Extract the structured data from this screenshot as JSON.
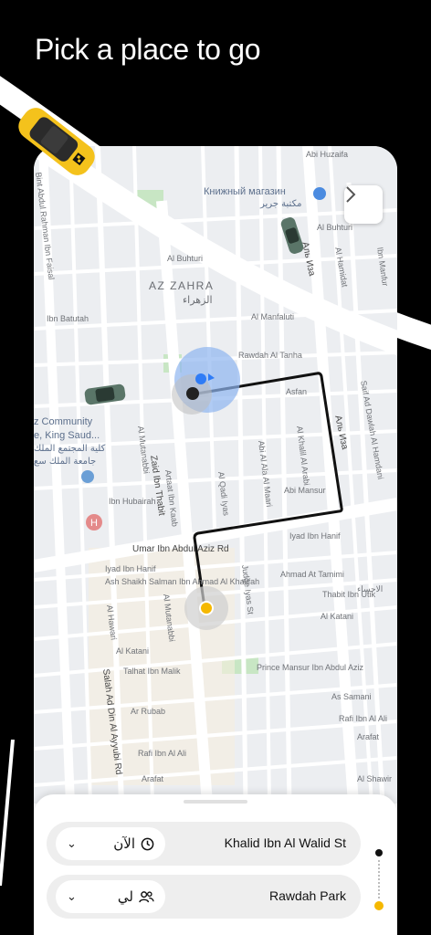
{
  "headline": "Pick a place to go",
  "map": {
    "area_title": "AZ ZAHRA",
    "area_subtitle": "الزهراء",
    "poi_bookstore": "Книжный магазин",
    "poi_bookstore_ar": "مكتبة جرير",
    "poi_community": "z Community",
    "poi_community_2": "e, King Saud...",
    "poi_community_ar": "كلية المجتمع الملك",
    "poi_community_ar2": "جامعة الملك سع",
    "streets": {
      "abi_huzaifa": "Abi Huzaifa",
      "al_buhturi_1": "Al Buhturi",
      "al_buhturi_2": "Al Buhturi",
      "ibn_batutah": "Ibn Batutah",
      "al_manfaluti": "Al Manfaluti",
      "rawdah_al_tanha": "Rawdah Al Tanha",
      "asfan": "Asfan",
      "ibn_hubairah": "Ibn Hubairah",
      "al_mutanabbi_1": "Al Mutanabbi",
      "zaid_ibn_thabit": "Zaid Ibn Thabit",
      "artaat": "Artaat Ibn Kaab",
      "al_qadi_iyas": "Al Qadi Iyas",
      "abi_al_ala": "Abi Al Ala Al Maari",
      "al_khalil": "Al Khalil Al Arabi",
      "abi_mansur": "Abi Mansur",
      "umar": "Umar Ibn Abdul Aziz Rd",
      "iyad_1": "Iyad Ibn Hanif",
      "iyad_2": "Iyad Ibn Hanif",
      "ash_shaikh": "Ash Shaikh Salman Ibn Ahmad Al Khalifah",
      "ahmad": "Ahmad At Tamimi",
      "thabit": "Thabit Ibn Utik",
      "al_katani_1": "Al Katani",
      "al_katani_2": "Al Katani",
      "talhat": "Talhat Ibn Malik",
      "prince_mansur": "Prince Mansur Ibn Abdul Aziz",
      "as_samani": "As Samani",
      "ar_rubab": "Ar Rubab",
      "rafi_1": "Rafi Ibn Al Ali",
      "rafi_2": "Rafi Ibn Al Ali",
      "arafat_1": "Arafat",
      "arafat_2": "Arafat",
      "ash_shawir": "Al Shawir",
      "salah": "Salah Ad Din Al Ayyubi Rd",
      "al_hawari": "Al Hawari",
      "al_mutanabbi_2": "Al Mutanabbi",
      "judge_iyas": "Judge Iyas St",
      "al_hamidat": "Al Hamidat",
      "al_manfur": "Ibn Manfur",
      "saif": "Saif Ad Dawlah Al Hamdani",
      "alizza_1": "Аль Иза",
      "alizza_2": "Аль Иза",
      "bint_abdul": "Bint Abdul Rahman Ibn Faisal",
      "al_ahsa": "الاحساء"
    }
  },
  "sheet": {
    "row1": {
      "pill_text": "الآن",
      "destination": "Khalid Ibn Al Walid St"
    },
    "row2": {
      "pill_text": "لي",
      "destination": "Rawdah Park"
    }
  }
}
